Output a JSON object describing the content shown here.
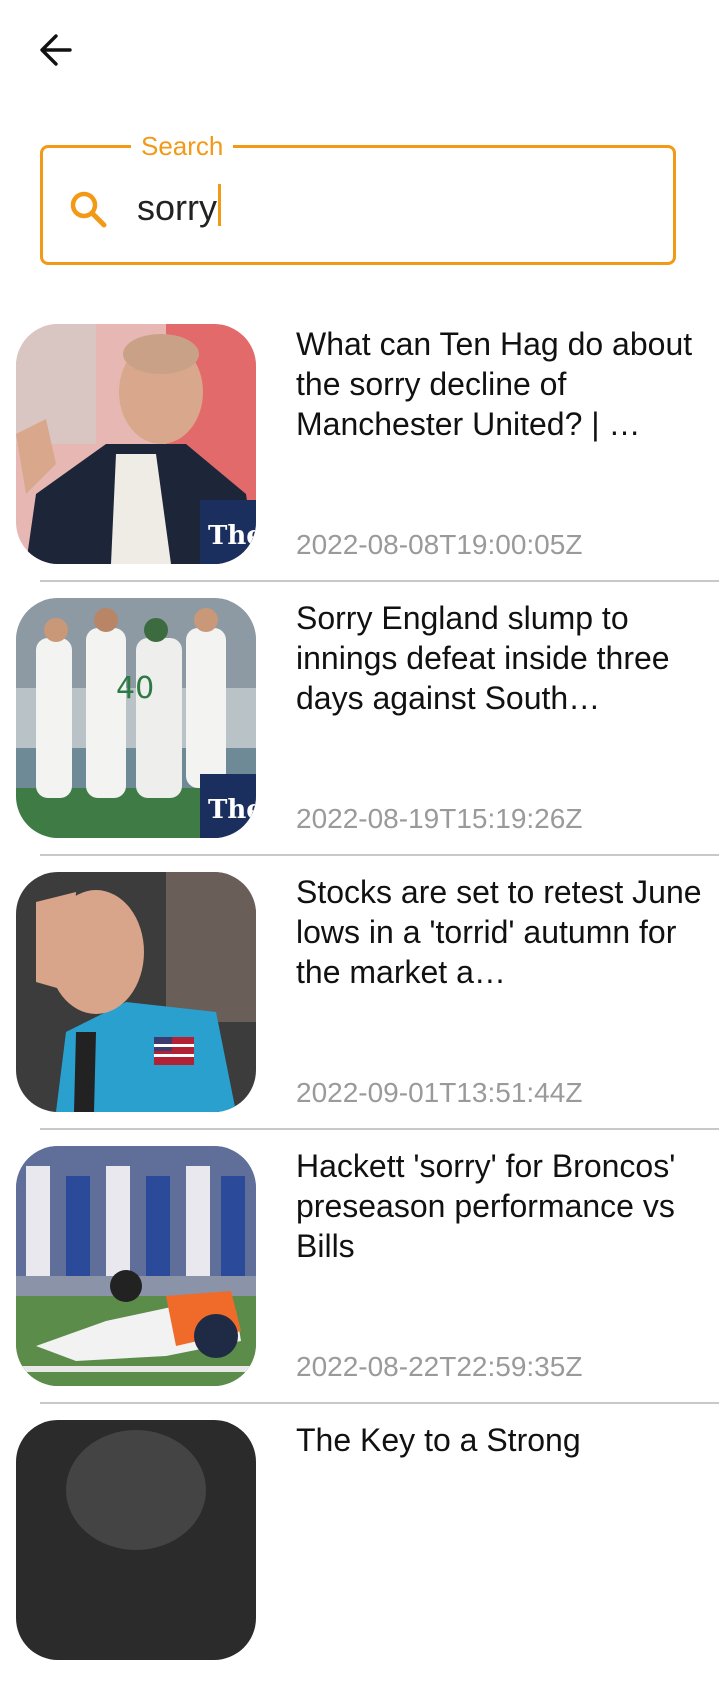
{
  "header": {
    "back_icon": "arrow-left-icon"
  },
  "search": {
    "label": "Search",
    "value": "sorry",
    "icon": "search-icon",
    "accent_color": "#f29a17"
  },
  "results": [
    {
      "title": "What can Ten Hag do about the sorry decline of Manchester United? | …",
      "date": "2022-08-08T19:00:05Z",
      "thumbnail_alt": "Man in dark blazer gesturing",
      "watermark": "The Gu"
    },
    {
      "title": "Sorry England slump to innings defeat inside three days against South…",
      "date": "2022-08-19T15:19:26Z",
      "thumbnail_alt": "Cricket players in white celebrating",
      "watermark": "The Gu"
    },
    {
      "title": "Stocks are set to retest June lows in a 'torrid' autumn for the market a…",
      "date": "2022-09-01T13:51:44Z",
      "thumbnail_alt": "Trader holding head in blue jacket"
    },
    {
      "title": "Hackett 'sorry' for Broncos' preseason performance vs Bills",
      "date": "2022-08-22T22:59:35Z",
      "thumbnail_alt": "Football player lying on field"
    },
    {
      "title": "The Key to a Strong",
      "date": "",
      "thumbnail_alt": "Dark portrait"
    }
  ]
}
